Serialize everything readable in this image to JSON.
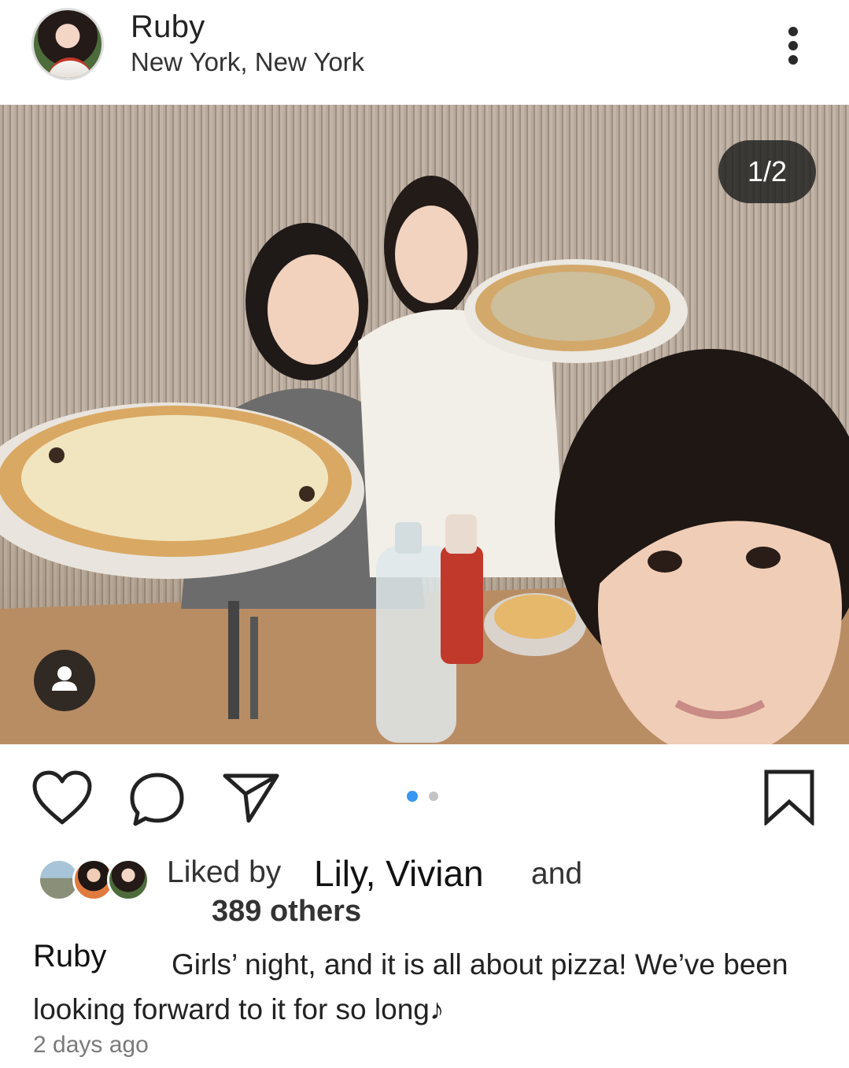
{
  "post": {
    "username": "Ruby",
    "location": "New York, New York",
    "more_icon": "more-vertical-icon",
    "photo_counter": "1/2",
    "photo_alt_scene": "photo",
    "carousel": {
      "total": 2,
      "current": 1,
      "active_color": "#3897f0",
      "inactive_color": "#c4c4c4"
    },
    "icons": {
      "like": "heart-icon",
      "comment": "comment-icon",
      "share": "send-icon",
      "save": "bookmark-icon",
      "tag": "person-icon"
    },
    "likes": {
      "prefix": "Liked by",
      "names": "Lily, Vivian",
      "and": "and",
      "others": "389 others"
    },
    "caption": {
      "user": "Ruby",
      "text": "Girls’ night, and it is all about pizza! We’ve been looking forward to it for so long♪"
    },
    "timestamp": "2 days ago"
  }
}
